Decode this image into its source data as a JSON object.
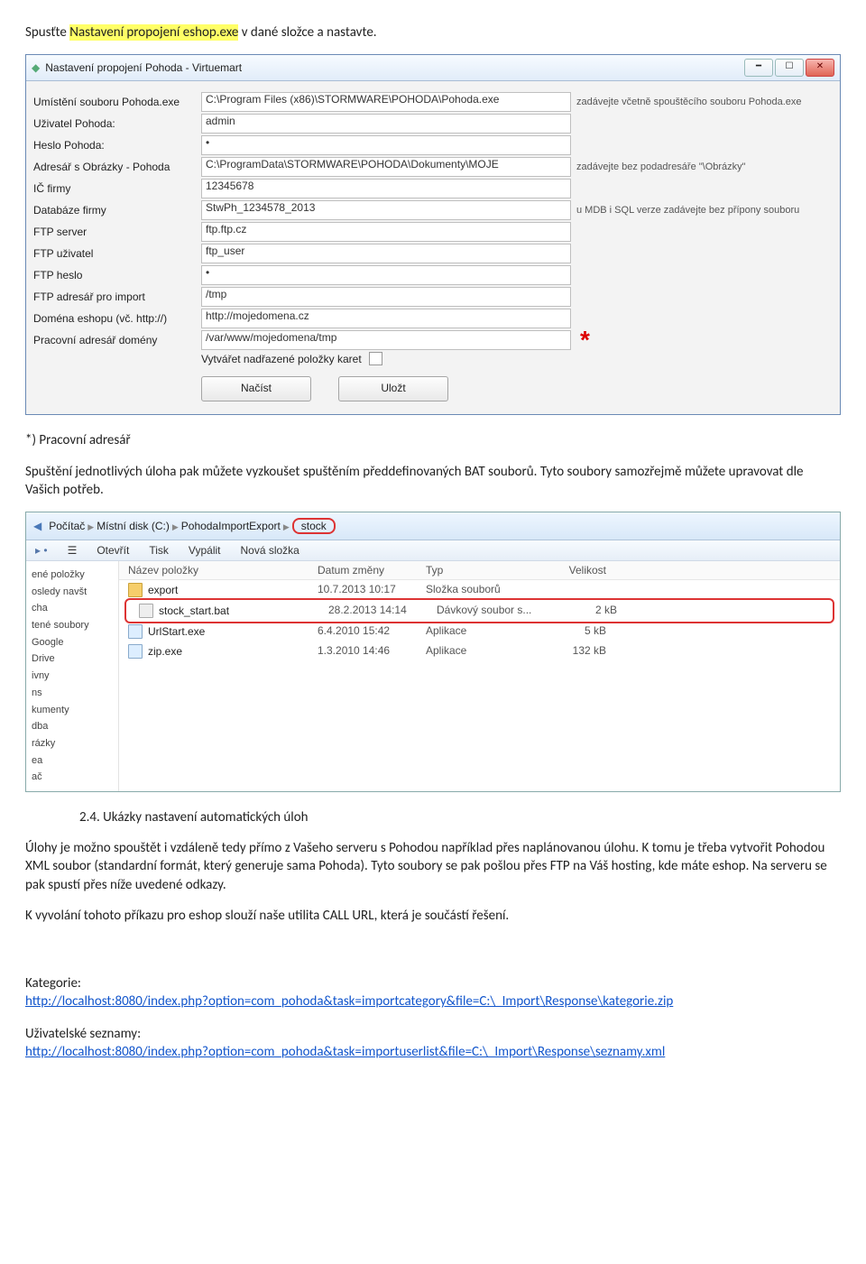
{
  "intro": {
    "prefix": "Spusťte ",
    "highlight": "Nastavení propojení eshop.exe",
    "suffix": " v dané složce a nastavte."
  },
  "settingsWindow": {
    "title": "Nastavení propojení Pohoda - Virtuemart",
    "rows": [
      {
        "label": "Umístění souboru Pohoda.exe",
        "value": "C:\\Program Files (x86)\\STORMWARE\\POHODA\\Pohoda.exe",
        "hint": "zadávejte včetně spouštěcího souboru Pohoda.exe"
      },
      {
        "label": "Uživatel Pohoda:",
        "value": "admin",
        "hint": ""
      },
      {
        "label": "Heslo Pohoda:",
        "value": "•",
        "hint": ""
      },
      {
        "label": "Adresář s Obrázky - Pohoda",
        "value": "C:\\ProgramData\\STORMWARE\\POHODA\\Dokumenty\\MOJE",
        "hint": "zadávejte bez podadresáře \"\\Obrázky\""
      },
      {
        "label": "IČ firmy",
        "value": "12345678",
        "hint": ""
      },
      {
        "label": "Databáze firmy",
        "value": "StwPh_1234578_2013",
        "hint": "u MDB i SQL verze zadávejte bez přípony souboru"
      },
      {
        "label": "FTP server",
        "value": "ftp.ftp.cz",
        "hint": ""
      },
      {
        "label": "FTP uživatel",
        "value": "ftp_user",
        "hint": ""
      },
      {
        "label": "FTP heslo",
        "value": "•",
        "hint": ""
      },
      {
        "label": "FTP adresář pro import",
        "value": "/tmp",
        "hint": ""
      },
      {
        "label": "Doména eshopu (vč. http://)",
        "value": "http://mojedomena.cz",
        "hint": ""
      },
      {
        "label": "Pracovní adresář domény",
        "value": "/var/www/mojedomena/tmp",
        "hint": "*",
        "asterisk": true
      }
    ],
    "checkboxLabel": "Vytvářet nadřazené položky karet",
    "buttons": {
      "load": "Načíst",
      "save": "Uložt"
    }
  },
  "midText": {
    "heading": "*) Pracovní adresář",
    "p1": "Spuštění jednotlivých úloha pak můžete vyzkoušet spuštěním předdefinovaných BAT souborů. Tyto soubory samozřejmě můžete upravovat dle Vašich potřeb."
  },
  "explorer": {
    "breadcrumb": [
      "Počítač",
      "Místní disk (C:)",
      "PohodaImportExport",
      "stock"
    ],
    "toolbar": [
      "Otevřít",
      "Tisk",
      "Vypálit",
      "Nová složka"
    ],
    "sideItems": [
      "ené položky",
      "osledy navšt",
      "cha",
      "tené soubory",
      "Google",
      "Drive",
      "",
      "ivny",
      "ns",
      "kumenty",
      "dba",
      "rázky",
      "ea",
      "",
      "ač"
    ],
    "columns": [
      "Název položky",
      "Datum změny",
      "Typ",
      "Velikost"
    ],
    "files": [
      {
        "icon": "folder",
        "name": "export",
        "date": "10.7.2013 10:17",
        "type": "Složka souborů",
        "size": ""
      },
      {
        "icon": "bat",
        "name": "stock_start.bat",
        "date": "28.2.2013 14:14",
        "type": "Dávkový soubor s...",
        "size": "2 kB",
        "selected": true
      },
      {
        "icon": "exe",
        "name": "UrlStart.exe",
        "date": "6.4.2010 15:42",
        "type": "Aplikace",
        "size": "5 kB"
      },
      {
        "icon": "exe",
        "name": "zip.exe",
        "date": "1.3.2010 14:46",
        "type": "Aplikace",
        "size": "132 kB"
      }
    ]
  },
  "section24": {
    "heading": "2.4. Ukázky nastavení automatických úloh",
    "p1": "Úlohy je možno spouštět i vzdáleně tedy přímo z Vašeho serveru s Pohodou například přes naplánovanou úlohu. K tomu je třeba vytvořit Pohodou XML soubor (standardní formát, který generuje sama Pohoda). Tyto soubory se pak pošlou přes FTP na Váš hosting, kde máte eshop. Na serveru se pak spustí přes níže uvedené odkazy.",
    "p2": "K vyvolání tohoto příkazu pro eshop slouží naše utilita CALL URL, která je součástí řešení."
  },
  "links": {
    "catLabel": "Kategorie:",
    "catUrl": "http://localhost:8080/index.php?option=com_pohoda&task=importcategory&file=C:\\_Import\\Response\\kategorie.zip",
    "userLabel": "Uživatelské seznamy:",
    "userUrl": "http://localhost:8080/index.php?option=com_pohoda&task=importuserlist&file=C:\\_Import\\Response\\seznamy.xml"
  }
}
